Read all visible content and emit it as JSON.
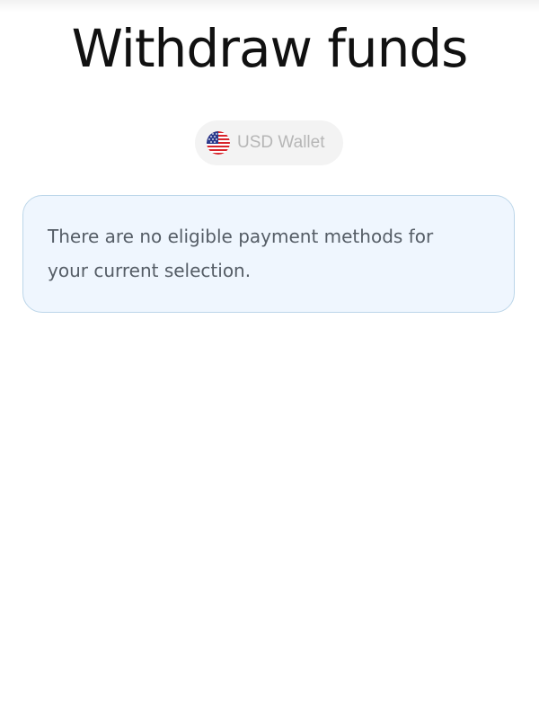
{
  "page": {
    "title": "Withdraw funds"
  },
  "wallet_selector": {
    "label": "USD Wallet",
    "flag_icon": "us-flag-icon"
  },
  "notice": {
    "message": "There are no eligible payment methods for your current selection."
  },
  "colors": {
    "title": "#111111",
    "chip_background": "#f3f3f3",
    "chip_text": "#b6b6b6",
    "notice_background": "#eff6fe",
    "notice_border": "#bcd6e9",
    "notice_text": "#555d66"
  }
}
